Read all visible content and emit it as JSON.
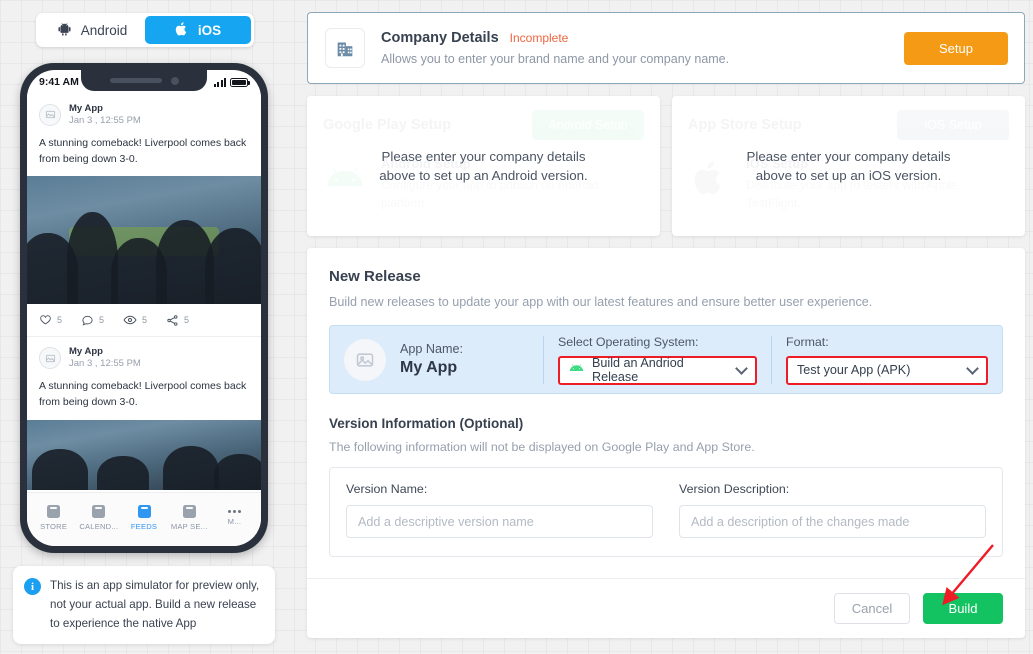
{
  "os_toggle": {
    "android": {
      "label": "Android",
      "icon": "android-icon"
    },
    "ios": {
      "label": "iOS",
      "icon": "apple-icon"
    },
    "active": "ios"
  },
  "phone_preview": {
    "status_bar": {
      "time": "9:41 AM",
      "signal_icon": "signal-bars-icon",
      "battery_icon": "battery-icon"
    },
    "posts": [
      {
        "author": "My App",
        "date": "Jan 3 , 12:55 PM",
        "text": "A stunning comeback! Liverpool comes back from being down 3-0.",
        "actions": [
          {
            "icon": "heart-icon",
            "count": "5"
          },
          {
            "icon": "comment-icon",
            "count": "5"
          },
          {
            "icon": "eye-icon",
            "count": "5"
          },
          {
            "icon": "share-icon",
            "count": "5"
          }
        ]
      },
      {
        "author": "My App",
        "date": "Jan 3 , 12:55 PM",
        "text": "A stunning comeback! Liverpool comes back from being down 3-0."
      }
    ],
    "tabs": [
      {
        "label": "STORE",
        "active": false
      },
      {
        "label": "CALEND...",
        "active": false
      },
      {
        "label": "FEEDS",
        "active": true
      },
      {
        "label": "MAP SE...",
        "active": false
      },
      {
        "label": "M...",
        "active": false
      }
    ],
    "note": "This is an app simulator for preview only, not your actual app. Build a new release to experience the native App"
  },
  "company_banner": {
    "icon": "building-icon",
    "title": "Company Details",
    "status": "Incomplete",
    "status_color": "#f0653f",
    "subtitle": "Allows you to enter your brand name and your company name.",
    "button_label": "Setup",
    "button_color": "#f59a15"
  },
  "store_cards": [
    {
      "ghost_title": "Google Play Setup",
      "ghost_button": "Android Setup",
      "ghost_sub": "Android Setup",
      "ghost_desc": "Configure your app to publish on Android platform.",
      "logo_icon": "android-logo-icon",
      "overlay_line1": "Please enter your company details",
      "overlay_line2": "above to set up an Android version."
    },
    {
      "ghost_title": "App Store Setup",
      "ghost_button": "iOS Setup",
      "ghost_sub": "iOS Setup",
      "ghost_desc": "Distribute your app to testers with Apple TestFlight.",
      "logo_icon": "apple-logo-icon",
      "overlay_line1": "Please enter your company details",
      "overlay_line2": "above to set up an iOS version."
    }
  ],
  "new_release": {
    "title": "New Release",
    "subtitle": "Build new releases to update your app with our latest features and ensure better user experience.",
    "app_name_label": "App Name:",
    "app_name_value": "My App",
    "app_avatar_icon": "image-placeholder-icon",
    "os_label": "Select Operating System:",
    "os_value": "Build an Andriod Release",
    "os_value_icon": "android-icon",
    "format_label": "Format:",
    "format_value": "Test your App (APK)",
    "highlight_color": "#ee1c25",
    "version_info_title": "Version Information (Optional)",
    "version_info_subtitle": "The following information will not be displayed on Google Play and App Store.",
    "version_name_label": "Version Name:",
    "version_name_value": "",
    "version_name_placeholder": "Add a descriptive version name",
    "version_desc_label": "Version Description:",
    "version_desc_value": "",
    "version_desc_placeholder": "Add a description of the changes made",
    "cancel_label": "Cancel",
    "build_label": "Build",
    "build_color": "#13c362"
  }
}
